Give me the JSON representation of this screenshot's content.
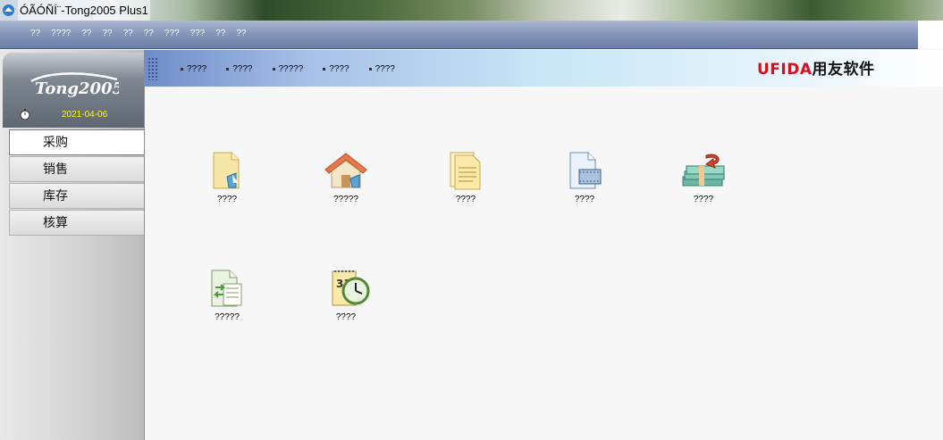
{
  "window": {
    "title": "ÓÃÓÑÍ¨-Tong2005 Plus1"
  },
  "menubar": {
    "items": [
      "??",
      "????",
      "??",
      "??",
      "??",
      "??",
      "???",
      "???",
      "??",
      "??"
    ]
  },
  "sidebar": {
    "logo_text": "Tong2005",
    "date": "2021-04-06",
    "items": [
      {
        "label": "采购",
        "active": true
      },
      {
        "label": "销售",
        "active": false
      },
      {
        "label": "库存",
        "active": false
      },
      {
        "label": "核算",
        "active": false
      }
    ]
  },
  "toolstrip": {
    "links": [
      "????",
      "????",
      "?????",
      "????",
      "????"
    ]
  },
  "brand": {
    "latin": "UFIDA",
    "chinese": "用友软件",
    "color": "#d6101e"
  },
  "tiles": [
    {
      "label": "????",
      "icon": "document-arrow-icon"
    },
    {
      "label": "?????",
      "icon": "house-icon"
    },
    {
      "label": "????",
      "icon": "documents-stack-icon"
    },
    {
      "label": "????",
      "icon": "document-film-icon"
    },
    {
      "label": "????",
      "icon": "money-return-icon"
    },
    {
      "label": "?????",
      "icon": "document-exchange-icon"
    },
    {
      "label": "????",
      "icon": "calendar-clock-icon"
    }
  ]
}
